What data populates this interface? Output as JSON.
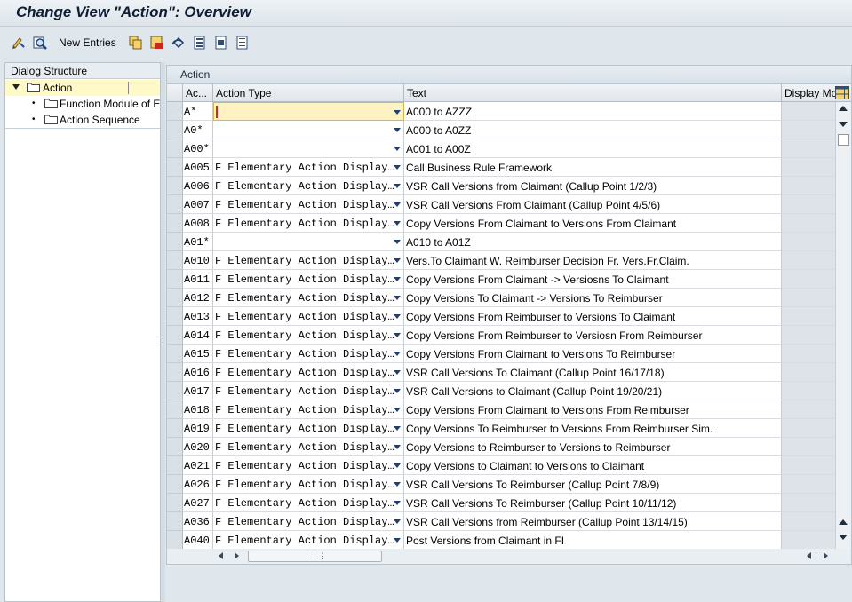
{
  "window": {
    "title": "Change View \"Action\": Overview"
  },
  "toolbar": {
    "new_entries_label": "New Entries",
    "icons": [
      "display-change-icon",
      "find-icon",
      "copy-icon",
      "delete-icon",
      "undo-icon",
      "select-all-icon",
      "select-block-icon",
      "deselect-all-icon"
    ]
  },
  "dialog_structure": {
    "header": "Dialog Structure",
    "items": [
      {
        "label": "Action",
        "level": 0,
        "selected": true
      },
      {
        "label": "Function Module of E",
        "level": 1,
        "selected": false
      },
      {
        "label": "Action Sequence",
        "level": 1,
        "selected": false
      }
    ]
  },
  "table": {
    "section_title": "Action",
    "columns": {
      "action": "Ac...",
      "action_type": "Action Type",
      "text": "Text",
      "display_mode": "Display Mo"
    },
    "rows": [
      {
        "action": "A*",
        "type": "",
        "text": "A000 to AZZZ"
      },
      {
        "action": "A0*",
        "type": "",
        "text": "A000 to A0ZZ"
      },
      {
        "action": "A00*",
        "type": "",
        "text": "A001 to A00Z"
      },
      {
        "action": "A005",
        "type": "F Elementary Action Display…",
        "text": "Call Business Rule Framework"
      },
      {
        "action": "A006",
        "type": "F Elementary Action Display…",
        "text": "VSR Call Versions from Claimant (Callup Point 1/2/3)"
      },
      {
        "action": "A007",
        "type": "F Elementary Action Display…",
        "text": "VSR Call Versions From Claimant (Callup Point 4/5/6)"
      },
      {
        "action": "A008",
        "type": "F Elementary Action Display…",
        "text": "Copy Versions From Claimant to Versions From Claimant"
      },
      {
        "action": "A01*",
        "type": "",
        "text": "A010 to A01Z"
      },
      {
        "action": "A010",
        "type": "F Elementary Action Display…",
        "text": "Vers.To Claimant W. Reimburser Decision Fr. Vers.Fr.Claim."
      },
      {
        "action": "A011",
        "type": "F Elementary Action Display…",
        "text": "Copy Versions From Claimant -> Versiosns To Claimant"
      },
      {
        "action": "A012",
        "type": "F Elementary Action Display…",
        "text": "Copy Versions To Claimant -> Versions To Reimburser"
      },
      {
        "action": "A013",
        "type": "F Elementary Action Display…",
        "text": "Copy Versions From Reimburser to Versions To Claimant"
      },
      {
        "action": "A014",
        "type": "F Elementary Action Display…",
        "text": "Copy Versions From Reimburser to Versiosn From Reimburser"
      },
      {
        "action": "A015",
        "type": "F Elementary Action Display…",
        "text": "Copy Versions From Claimant to Versions To Reimburser"
      },
      {
        "action": "A016",
        "type": "F Elementary Action Display…",
        "text": "VSR Call Versions To Claimant (Callup Point 16/17/18)"
      },
      {
        "action": "A017",
        "type": "F Elementary Action Display…",
        "text": "VSR Call Versions to Claimant (Callup Point 19/20/21)"
      },
      {
        "action": "A018",
        "type": "F Elementary Action Display…",
        "text": "Copy Versions From Claimant to Versions From Reimburser"
      },
      {
        "action": "A019",
        "type": "F Elementary Action Display…",
        "text": "Copy Versions To Reimburser to Versions From Reimburser Sim."
      },
      {
        "action": "A020",
        "type": "F Elementary Action Display…",
        "text": "Copy Versions to Reimburser to Versions to Reimburser"
      },
      {
        "action": "A021",
        "type": "F Elementary Action Display…",
        "text": "Copy Versions to Claimant to Versions to Claimant"
      },
      {
        "action": "A026",
        "type": "F Elementary Action Display…",
        "text": "VSR Call Versions To Reimburser (Callup Point 7/8/9)"
      },
      {
        "action": "A027",
        "type": "F Elementary Action Display…",
        "text": "VSR Call Versions To Reimburser (Callup Point 10/11/12)"
      },
      {
        "action": "A036",
        "type": "F Elementary Action Display…",
        "text": "VSR Call Versions from Reimburser (Callup Point 13/14/15)"
      },
      {
        "action": "A040",
        "type": "F Elementary Action Display…",
        "text": "Post Versions from Claimant in FI"
      }
    ]
  }
}
